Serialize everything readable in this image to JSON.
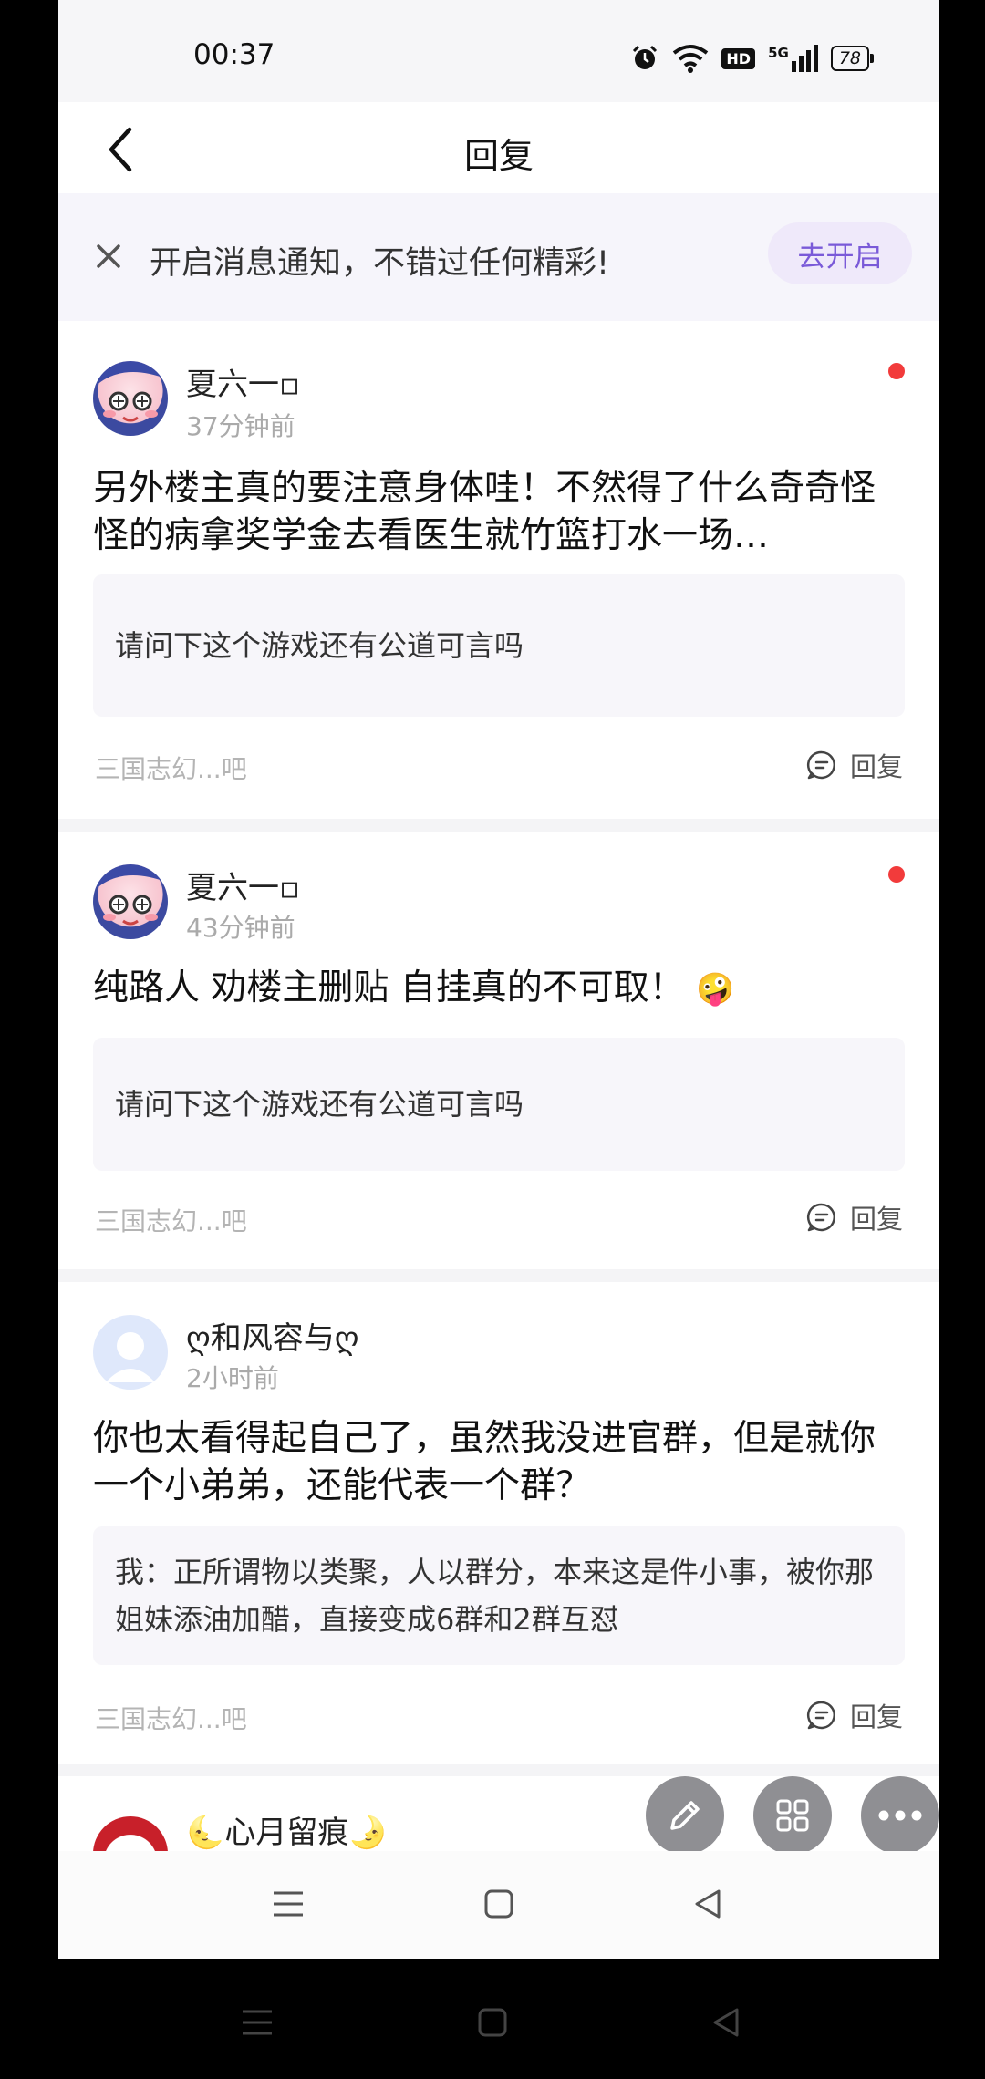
{
  "status_bar": {
    "time": "00:37",
    "network": "5G",
    "hd": "HD",
    "battery": "78"
  },
  "header": {
    "title": "回复"
  },
  "notify_banner": {
    "text": "开启消息通知，不错过任何精彩!",
    "button_label": "去开启"
  },
  "replies": [
    {
      "username": "夏六一▫",
      "time": "37分钟前",
      "unread": true,
      "content": "另外楼主真的要注意身体哇！不然得了什么奇奇怪怪的病拿奖学金去看医生就竹篮打水一场…",
      "quote": "请问下这个游戏还有公道可言吗",
      "forum": "三国志幻...吧",
      "reply_label": "回复"
    },
    {
      "username": "夏六一▫",
      "time": "43分钟前",
      "unread": true,
      "content": "纯路人 劝楼主删贴 自挂真的不可取！",
      "emoji": "🤪",
      "quote": "请问下这个游戏还有公道可言吗",
      "forum": "三国志幻...吧",
      "reply_label": "回复"
    },
    {
      "username": "ღ和风容与ღ",
      "time": "2小时前",
      "unread": false,
      "content": "你也太看得起自己了，虽然我没进官群，但是就你一个小弟弟，还能代表一个群？",
      "quote": "我：正所谓物以类聚，人以群分，本来这是件小事，被你那姐妹添油加醋，直接变成6群和2群互怼",
      "forum": "三国志幻...吧",
      "reply_label": "回复"
    },
    {
      "username": "🌜心月留痕🌛"
    }
  ],
  "fab": {
    "edit_icon": "pencil-icon",
    "apps_icon": "grid-icon",
    "more_icon": "more-dots-icon"
  },
  "colors": {
    "accent": "#7a5ad8",
    "unread_dot": "#f23b3b",
    "banner_bg": "#f6f5fb",
    "fab_bg": "#8f8f93"
  }
}
